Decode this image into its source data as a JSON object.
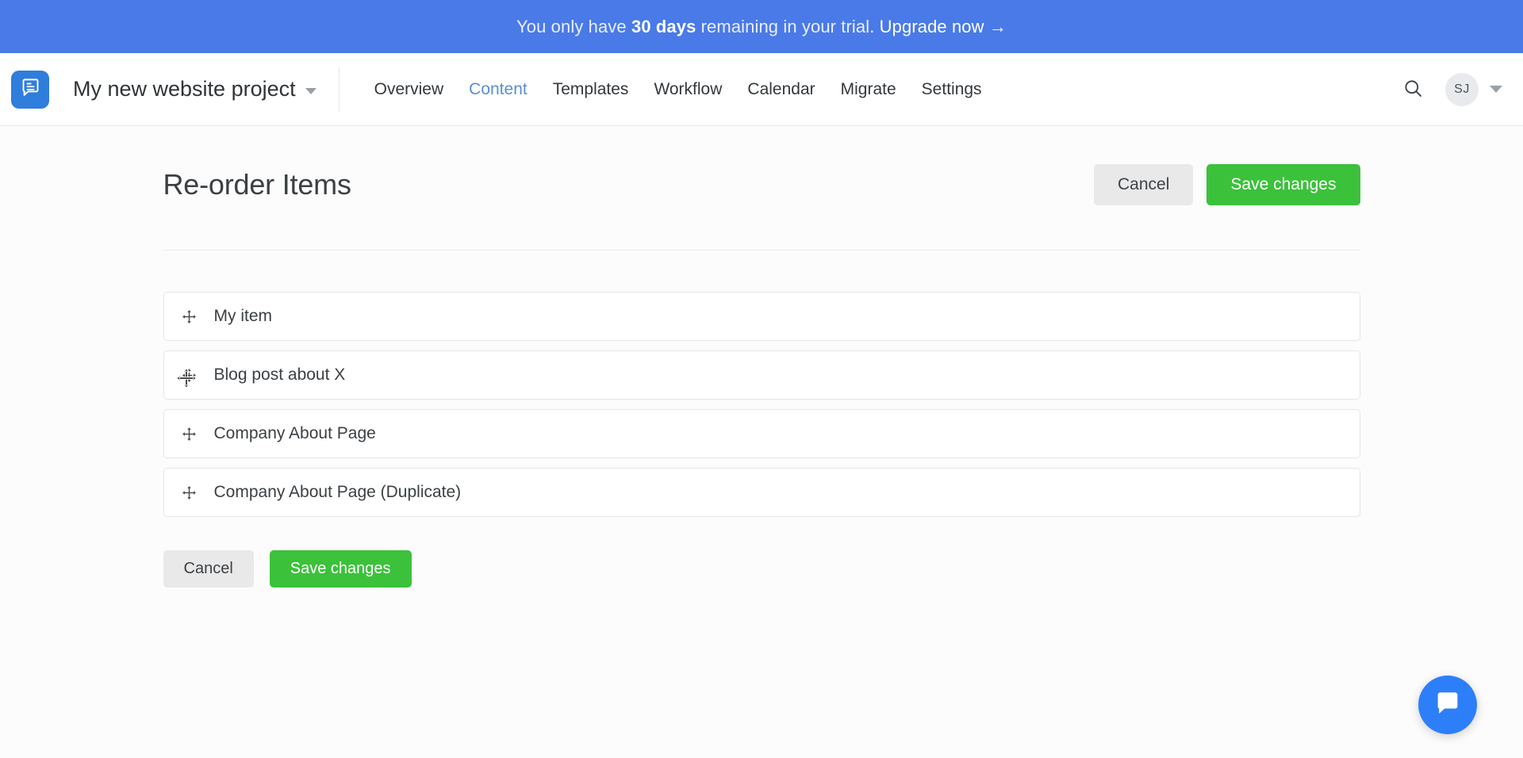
{
  "banner": {
    "prefix": "You only have ",
    "highlight": "30 days",
    "suffix": " remaining in your trial. ",
    "link": "Upgrade now →",
    "bg_color": "#4a7ae8"
  },
  "header": {
    "logo_icon": "document-logo-icon",
    "project_name": "My new website project",
    "project_caret_icon": "chevron-down-icon",
    "nav": [
      {
        "label": "Overview",
        "active": false
      },
      {
        "label": "Content",
        "active": true
      },
      {
        "label": "Templates",
        "active": false
      },
      {
        "label": "Workflow",
        "active": false
      },
      {
        "label": "Calendar",
        "active": false
      },
      {
        "label": "Migrate",
        "active": false
      },
      {
        "label": "Settings",
        "active": false
      }
    ],
    "search_icon": "search-icon",
    "avatar_initials": "SJ",
    "avatar_caret_icon": "chevron-down-icon",
    "active_color": "#5a8dd6"
  },
  "page": {
    "title": "Re-order Items",
    "cancel_label": "Cancel",
    "save_label": "Save changes",
    "primary_color": "#3cc13b",
    "secondary_color": "#e9e9e9"
  },
  "items": [
    {
      "label": "My item",
      "handle_icon": "drag-move-icon"
    },
    {
      "label": "Blog post about X",
      "handle_icon": "drag-move-icon"
    },
    {
      "label": "Company About Page",
      "handle_icon": "drag-move-icon"
    },
    {
      "label": "Company About Page (Duplicate)",
      "handle_icon": "drag-move-icon"
    }
  ],
  "bottom": {
    "cancel_label": "Cancel",
    "save_label": "Save changes"
  },
  "chat": {
    "icon": "chat-bubble-icon",
    "color": "#2d7ff9"
  }
}
